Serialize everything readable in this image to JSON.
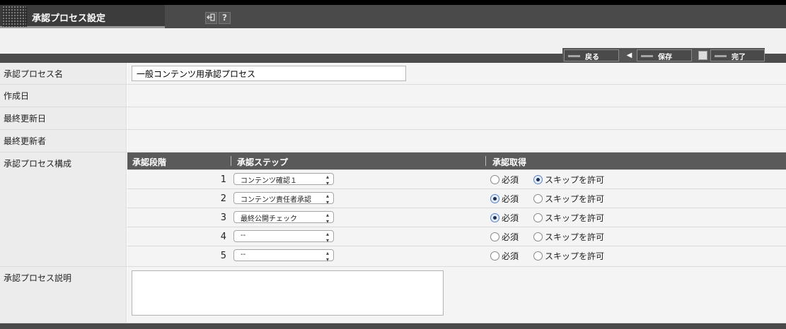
{
  "window": {
    "title": "承認プロセス設定"
  },
  "toolbar": {
    "icon_exit": "exit-icon",
    "icon_help": "?"
  },
  "actions": {
    "back_label": "戻る",
    "save_label": "保存",
    "done_label": "完了"
  },
  "form": {
    "name_label": "承認プロセス名",
    "name_value": "一般コンテンツ用承認プロセス",
    "created_label": "作成日",
    "created_value": "",
    "updated_label": "最終更新日",
    "updated_value": "",
    "updater_label": "最終更新者",
    "updater_value": "",
    "config_label": "承認プロセス構成",
    "desc_label": "承認プロセス説明",
    "desc_value": ""
  },
  "process_table": {
    "headers": {
      "stage": "承認段階",
      "step": "承認ステップ",
      "acquire": "承認取得"
    },
    "required_label": "必須",
    "skip_label": "スキップを許可",
    "rows": [
      {
        "stage": "1",
        "step": "コンテンツ確認１",
        "required": false,
        "skip": true
      },
      {
        "stage": "2",
        "step": "コンテンツ責任者承認",
        "required": true,
        "skip": false
      },
      {
        "stage": "3",
        "step": "最終公開チェック",
        "required": true,
        "skip": false
      },
      {
        "stage": "4",
        "step": "--",
        "required": false,
        "skip": false
      },
      {
        "stage": "5",
        "step": "--",
        "required": false,
        "skip": false
      }
    ]
  }
}
